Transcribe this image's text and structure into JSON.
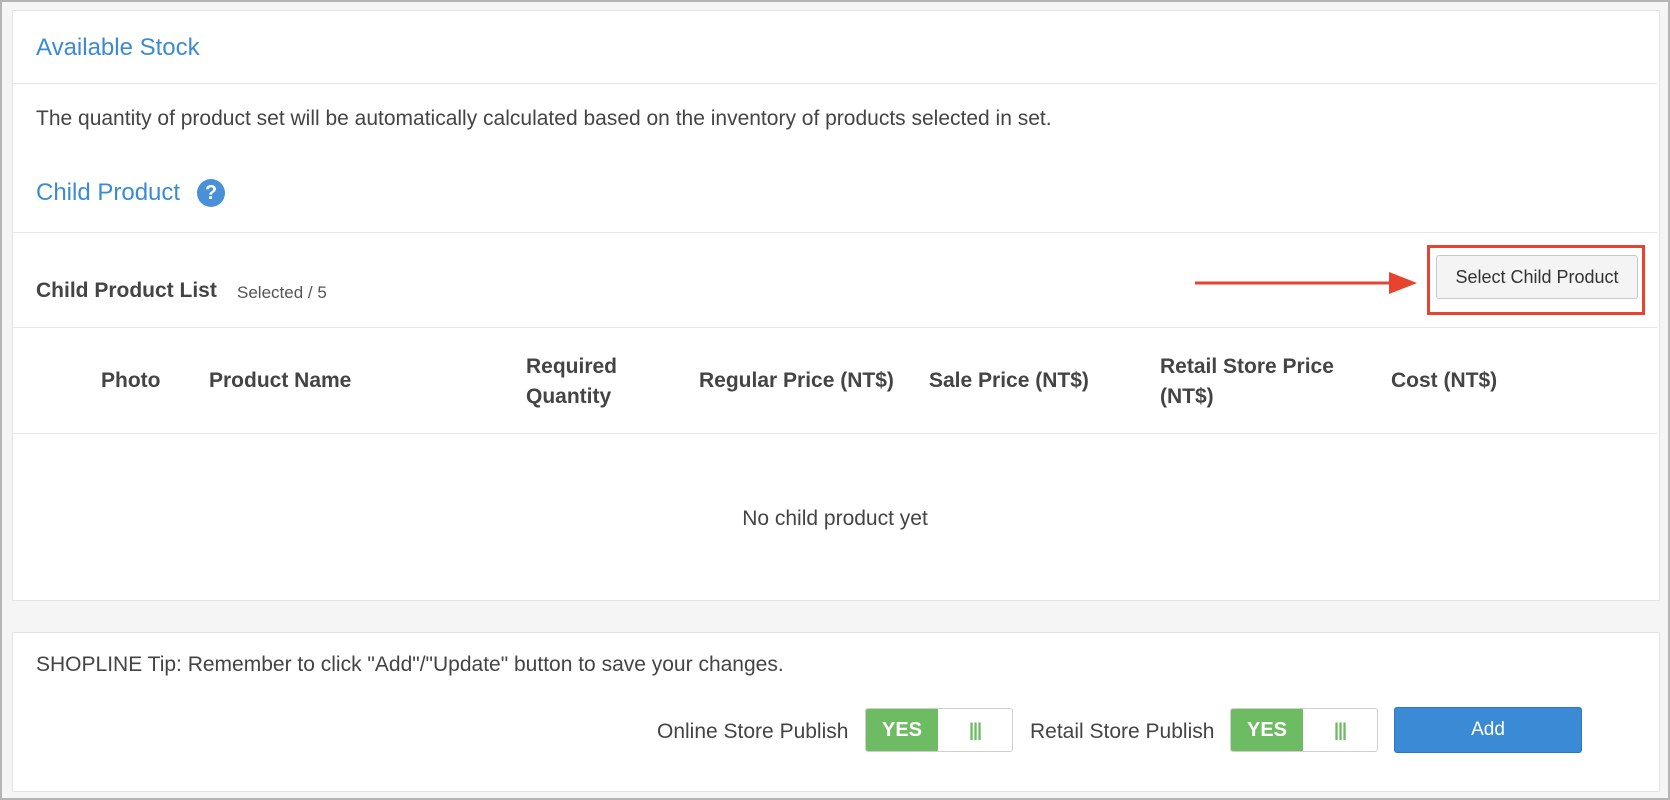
{
  "available_stock": {
    "title": "Available Stock",
    "description": "The quantity of product set will be automatically calculated based on the inventory of products selected in set."
  },
  "child_product": {
    "title": "Child Product",
    "help_icon": "question-circle-icon",
    "list_title": "Child Product List",
    "selected_count": "Selected / 5",
    "select_button_label": "Select Child Product",
    "columns": {
      "photo": "Photo",
      "product_name": "Product Name",
      "required_quantity": "Required Quantity",
      "regular_price": "Regular Price (NT$)",
      "sale_price": "Sale Price (NT$)",
      "retail_store_price": "Retail Store Price (NT$)",
      "cost": "Cost (NT$)"
    },
    "empty_message": "No child product yet"
  },
  "footer": {
    "tip": "SHOPLINE Tip: Remember to click \"Add\"/\"Update\" button to save your changes.",
    "online_store_publish_label": "Online Store Publish",
    "online_store_publish_value": "YES",
    "retail_store_publish_label": "Retail Store Publish",
    "retail_store_publish_value": "YES",
    "toggle_grip": "|||",
    "add_label": "Add"
  },
  "colors": {
    "accent": "#3b8bd4",
    "toggle_on": "#6dbb63",
    "annotation": "#e8432e",
    "primary_button": "#3a8ad6"
  }
}
